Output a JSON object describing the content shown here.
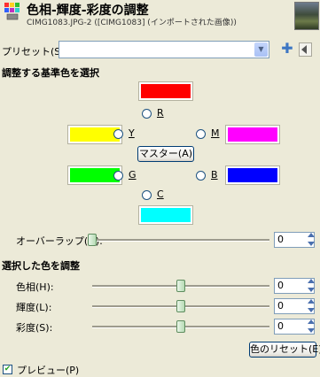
{
  "header": {
    "title": "色相-輝度-彩度の調整",
    "subtitle": "CIMG1083.JPG-2 ([CIMG1083] (インポートされた画像))"
  },
  "preset": {
    "label": "プリセット(S):",
    "value": ""
  },
  "primary": {
    "section_title": "調整する基準色を選択",
    "colors": {
      "red": "#ff0000",
      "yellow": "#ffff00",
      "magenta": "#ff00ff",
      "green": "#00ff00",
      "blue": "#0000ff",
      "cyan": "#00ffff"
    },
    "labels": {
      "r": "R",
      "y": "Y",
      "m": "M",
      "g": "G",
      "b": "B",
      "c": "C"
    },
    "master_label": "マスター(A)"
  },
  "overlap": {
    "label": "オーバーラップ(O):",
    "value": "0",
    "level": 0
  },
  "adjust": {
    "section_title": "選択した色を調整",
    "hue": {
      "label": "色相(H):",
      "value": "0",
      "level": 0.5
    },
    "lightness": {
      "label": "輝度(L):",
      "value": "0",
      "level": 0.5
    },
    "saturation": {
      "label": "彩度(S):",
      "value": "0",
      "level": 0.5
    },
    "reset_label": "色のリセット(E)"
  },
  "preview": {
    "label": "プレビュー(P)",
    "checked": true
  }
}
